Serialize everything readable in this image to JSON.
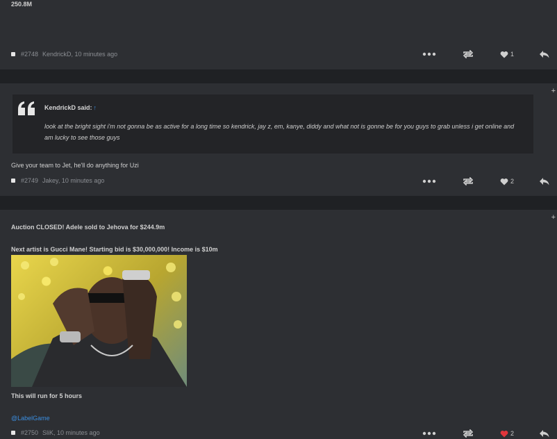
{
  "posts": [
    {
      "top_text": "250.8M",
      "number": "#2748",
      "meta": "KendrickD, 10 minutes ago",
      "likes": "1",
      "liked": false
    },
    {
      "quote_author": "KendrickD said:",
      "quote_arrow": "↑",
      "quote_text": "look at the bright sight i'm not gonna be as active for a long time so kendrick, jay z, em, kanye, diddy and what not is gonne be for you guys to grab unless i get online and am lucky to see those guys",
      "body": "Give your team to Jet, he'll do anything for Uzi",
      "number": "#2749",
      "meta": "Jakey, 10 minutes ago",
      "likes": "2",
      "liked": false
    },
    {
      "line1": "Auction CLOSED! Adele sold to Jehova for $244.9m",
      "line2": "Next artist is Gucci Mane! Starting bid is $30,000,000! Income is $10m",
      "line3": "This will run for 5 hours",
      "mention": "@LabelGame",
      "number": "#2750",
      "meta": "SliK, 10 minutes ago",
      "likes": "2",
      "liked": true
    }
  ],
  "plus_label": "+",
  "colors": {
    "accent": "#3b8ee0",
    "heart_active": "#e0353b",
    "panel": "#2d2f33",
    "divider": "#1f2124"
  }
}
